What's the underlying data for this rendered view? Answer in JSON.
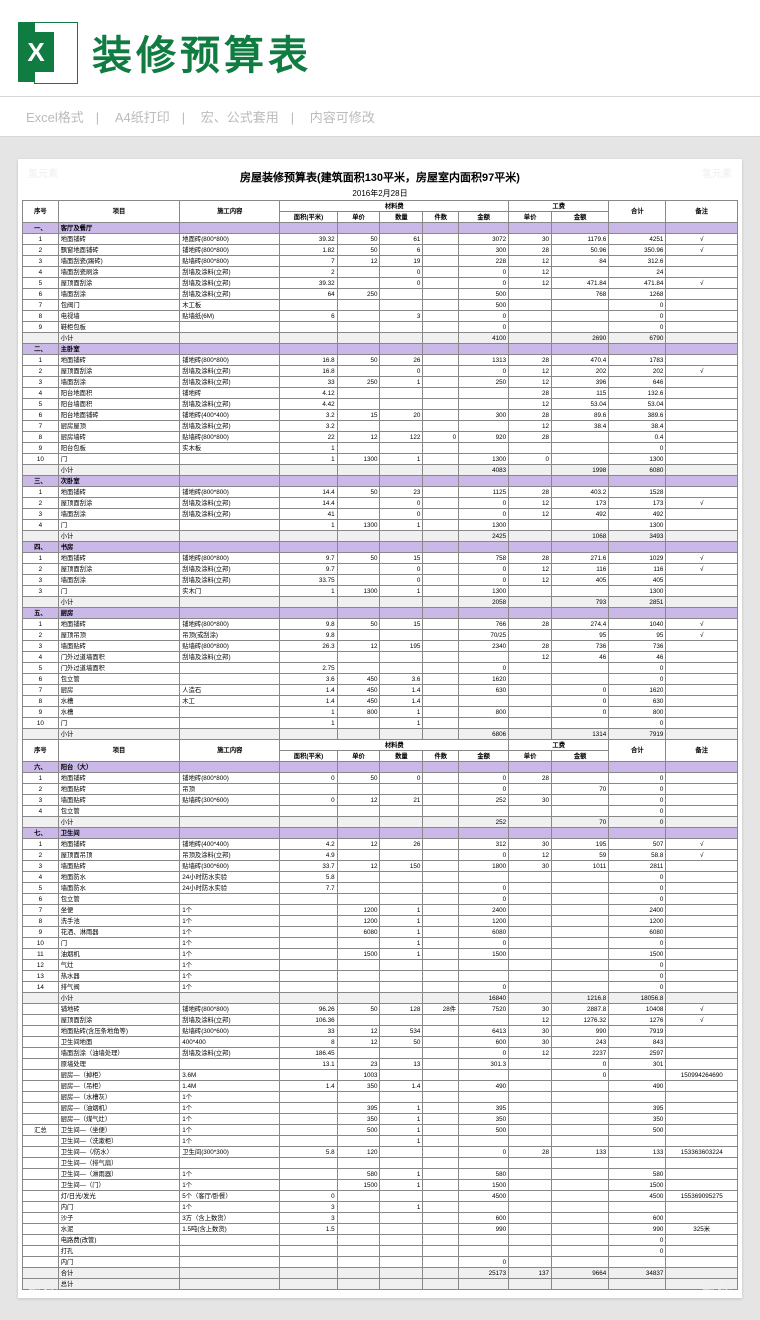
{
  "header": {
    "title": "装修预算表"
  },
  "meta": {
    "a": "Excel格式",
    "b": "A4纸打印",
    "c": "宏、公式套用",
    "d": "内容可修改"
  },
  "sheet": {
    "title": "房屋装修预算表(建筑面积130平米，房屋室内面积97平米)",
    "date": "2016年2月28日",
    "cols": [
      "序号",
      "项目",
      "施工内容",
      "面积(平米)",
      "单价",
      "数量",
      "件数",
      "金额",
      "单价",
      "金额",
      "合计",
      "备注"
    ],
    "grp": {
      "mat": "材料费",
      "lab": "工费"
    },
    "rows": [
      {
        "t": "sec",
        "n": "一、",
        "a": "客厅及餐厅"
      },
      {
        "n": "1",
        "a": "地面铺砖",
        "b": "地面砖(800*800)",
        "c": "39.32",
        "d": "50",
        "e": "61",
        "g": "3072",
        "h": "30",
        "i": "1179.6",
        "j": "4251",
        "k": "√"
      },
      {
        "n": "2",
        "a": "飘窗地面铺砖",
        "b": "铺地砖(800*800)",
        "c": "1.82",
        "d": "50",
        "e": "6",
        "g": "300",
        "h": "28",
        "i": "50.96",
        "j": "350.96",
        "k": "√"
      },
      {
        "n": "3",
        "a": "墙面刮瓷(踢砖)",
        "b": "贴墙砖(800*800)",
        "c": "7",
        "d": "12",
        "e": "19",
        "g": "228",
        "h": "12",
        "i": "84",
        "j": "312.6"
      },
      {
        "n": "4",
        "a": "墙面刮瓷刷涂",
        "b": "刮墙及涂料(立邦)",
        "c": "2",
        "e": "0",
        "g": "0",
        "h": "12",
        "j": "24"
      },
      {
        "n": "5",
        "a": "屋顶面刮涂",
        "b": "刮墙及涂料(立邦)",
        "c": "39.32",
        "e": "0",
        "g": "0",
        "h": "12",
        "i": "471.84",
        "j": "471.84",
        "k": "√"
      },
      {
        "n": "6",
        "a": "墙面刮涂",
        "b": "刮墙及涂料(立邦)",
        "c": "64",
        "d": "250",
        "g": "500",
        "i": "768",
        "j": "1268"
      },
      {
        "n": "7",
        "a": "包阀门",
        "b": "木工板",
        "g": "500",
        "j": "0"
      },
      {
        "n": "8",
        "a": "电视墙",
        "b": "贴墙纸(6M)",
        "c": "6",
        "e": "3",
        "g": "0",
        "j": "0"
      },
      {
        "n": "9",
        "a": "鞋柜包板",
        "g": "0",
        "j": "0"
      },
      {
        "t": "sub",
        "a": "小计",
        "g": "4100",
        "i": "2690",
        "j": "6790"
      },
      {
        "t": "sec",
        "n": "二、",
        "a": "主卧室"
      },
      {
        "n": "1",
        "a": "地面铺砖",
        "b": "铺地砖(800*800)",
        "c": "16.8",
        "d": "50",
        "e": "26",
        "g": "1313",
        "h": "28",
        "i": "470.4",
        "j": "1783"
      },
      {
        "n": "2",
        "a": "屋顶面刮涂",
        "b": "刮墙及涂料(立邦)",
        "c": "16.8",
        "e": "0",
        "g": "0",
        "h": "12",
        "i": "202",
        "j": "202",
        "k": "√"
      },
      {
        "n": "3",
        "a": "墙面刮涂",
        "b": "刮墙及涂料(立邦)",
        "c": "33",
        "d": "250",
        "e": "1",
        "g": "250",
        "h": "12",
        "i": "396",
        "j": "646"
      },
      {
        "n": "4",
        "a": "阳台地面积",
        "b": "铺地砖",
        "c": "4.12",
        "g": "",
        "h": "28",
        "i": "115",
        "j": "132.6"
      },
      {
        "n": "5",
        "a": "阳台墙面积",
        "b": "刮墙及涂料(立邦)",
        "c": "4.42",
        "g": "",
        "h": "12",
        "i": "53.04",
        "j": "53.04"
      },
      {
        "n": "6",
        "a": "阳台地面铺砖",
        "b": "铺地砖(400*400)",
        "c": "3.2",
        "d": "15",
        "e": "20",
        "g": "300",
        "h": "28",
        "i": "89.6",
        "j": "389.6"
      },
      {
        "n": "7",
        "a": "厨房屋顶",
        "b": "刮墙及涂料(立邦)",
        "c": "3.2",
        "g": "",
        "h": "12",
        "i": "38.4",
        "j": "38.4"
      },
      {
        "n": "8",
        "a": "厨房墙砖",
        "b": "贴墙砖(800*800)",
        "c": "22",
        "d": "12",
        "e": "122",
        "f": "0",
        "g": "920",
        "h": "28",
        "j": "0.4"
      },
      {
        "n": "9",
        "a": "阳台包板",
        "b": "实木板",
        "c": "1",
        "j": "0"
      },
      {
        "n": "10",
        "a": "门",
        "c": "1",
        "d": "1300",
        "e": "1",
        "g": "1300",
        "h": "0",
        "j": "1300"
      },
      {
        "t": "sub",
        "a": "小计",
        "g": "4083",
        "i": "1998",
        "j": "6080"
      },
      {
        "t": "sec",
        "n": "三、",
        "a": "次卧室"
      },
      {
        "n": "1",
        "a": "地面铺砖",
        "b": "铺地砖(800*800)",
        "c": "14.4",
        "d": "50",
        "e": "23",
        "g": "1125",
        "h": "28",
        "i": "403.2",
        "j": "1528"
      },
      {
        "n": "2",
        "a": "屋顶面刮涂",
        "b": "刮墙及涂料(立邦)",
        "c": "14.4",
        "e": "0",
        "g": "0",
        "h": "12",
        "i": "173",
        "j": "173",
        "k": "√"
      },
      {
        "n": "3",
        "a": "墙面刮涂",
        "b": "刮墙及涂料(立邦)",
        "c": "41",
        "e": "0",
        "g": "0",
        "h": "12",
        "i": "492",
        "j": "492"
      },
      {
        "n": "4",
        "a": "门",
        "c": "1",
        "d": "1300",
        "e": "1",
        "g": "1300",
        "j": "1300"
      },
      {
        "t": "sub",
        "a": "小计",
        "g": "2425",
        "i": "1068",
        "j": "3493"
      },
      {
        "t": "sec",
        "n": "四、",
        "a": "书房"
      },
      {
        "n": "1",
        "a": "地面铺砖",
        "b": "铺地砖(800*800)",
        "c": "9.7",
        "d": "50",
        "e": "15",
        "g": "758",
        "h": "28",
        "i": "271.6",
        "j": "1029",
        "k": "√"
      },
      {
        "n": "2",
        "a": "屋顶面刮涂",
        "b": "刮墙及涂料(立邦)",
        "c": "9.7",
        "e": "0",
        "g": "0",
        "h": "12",
        "i": "116",
        "j": "116",
        "k": "√"
      },
      {
        "n": "3",
        "a": "墙面刮涂",
        "b": "刮墙及涂料(立邦)",
        "c": "33.75",
        "e": "0",
        "g": "0",
        "h": "12",
        "i": "405",
        "j": "405"
      },
      {
        "n": "3",
        "a": "门",
        "b": "实木门",
        "c": "1",
        "d": "1300",
        "e": "1",
        "g": "1300",
        "j": "1300"
      },
      {
        "t": "sub",
        "a": "小计",
        "g": "2058",
        "i": "793",
        "j": "2851"
      },
      {
        "t": "sec",
        "n": "五、",
        "a": "厨房"
      },
      {
        "n": "1",
        "a": "地面铺砖",
        "b": "铺地砖(800*800)",
        "c": "9.8",
        "d": "50",
        "e": "15",
        "g": "766",
        "h": "28",
        "i": "274.4",
        "j": "1040",
        "k": "√"
      },
      {
        "n": "2",
        "a": "屋顶吊顶",
        "b": "吊顶(或刮涂)",
        "c": "9.8",
        "g": "70/25",
        "i": "95",
        "j": "95",
        "k": "√"
      },
      {
        "n": "3",
        "a": "墙面贴砖",
        "b": "贴墙砖(800*800)",
        "c": "26.3",
        "d": "12",
        "e": "195",
        "g": "2340",
        "h": "28",
        "i": "736",
        "j": "736"
      },
      {
        "n": "4",
        "a": "门外过道墙面积",
        "b": "刮墙及涂料(立邦)",
        "g": "",
        "h": "12",
        "i": "46",
        "j": "46"
      },
      {
        "n": "5",
        "a": "门外过道墙面积",
        "c": "2.75",
        "g": "0",
        "j": "0"
      },
      {
        "n": "6",
        "a": "包立管",
        "c": "3.6",
        "d": "450",
        "e": "3.6",
        "g": "1620",
        "j": "0"
      },
      {
        "n": "7",
        "a": "厨房",
        "b": "人造石",
        "c": "1.4",
        "d": "450",
        "e": "1.4",
        "g": "630",
        "i": "0",
        "j": "1620"
      },
      {
        "n": "8",
        "a": "水槽",
        "b": "木工",
        "c": "1.4",
        "d": "450",
        "e": "1.4",
        "g": "",
        "i": "0",
        "j": "630"
      },
      {
        "n": "9",
        "a": "水槽",
        "c": "1",
        "d": "800",
        "e": "1",
        "g": "800",
        "i": "0",
        "j": "800"
      },
      {
        "n": "10",
        "a": "门",
        "c": "1",
        "d": "",
        "e": "1",
        "g": "",
        "j": "0"
      },
      {
        "t": "sub",
        "a": "小计",
        "g": "6806",
        "i": "1314",
        "j": "7919"
      },
      {
        "t": "hdr"
      },
      {
        "t": "sec",
        "n": "六、",
        "a": "阳台（大）"
      },
      {
        "n": "1",
        "a": "地面铺砖",
        "b": "铺地砖(800*800)",
        "c": "0",
        "d": "50",
        "e": "0",
        "g": "0",
        "h": "28",
        "j": "0"
      },
      {
        "n": "2",
        "a": "地面贴砖",
        "b": "吊顶",
        "g": "0",
        "i": "70",
        "j": "0"
      },
      {
        "n": "3",
        "a": "墙面贴砖",
        "b": "贴墙砖(300*600)",
        "c": "0",
        "d": "12",
        "e": "21",
        "g": "252",
        "h": "30",
        "j": "0"
      },
      {
        "n": "4",
        "a": "包立管",
        "g": "",
        "j": "0"
      },
      {
        "t": "sub",
        "a": "小计",
        "g": "252",
        "i": "70",
        "j": "0"
      },
      {
        "t": "sec",
        "n": "七、",
        "a": "卫生间"
      },
      {
        "n": "1",
        "a": "地面铺砖",
        "b": "铺地砖(400*400)",
        "c": "4.2",
        "d": "12",
        "e": "26",
        "g": "312",
        "h": "30",
        "i": "195",
        "j": "507",
        "k": "√"
      },
      {
        "n": "2",
        "a": "屋顶面吊顶",
        "b": "吊顶及涂料(立邦)",
        "c": "4.9",
        "g": "0",
        "h": "12",
        "i": "59",
        "j": "58.8",
        "k": "√"
      },
      {
        "n": "3",
        "a": "墙面贴砖",
        "b": "贴墙砖(300*600)",
        "c": "33.7",
        "d": "12",
        "e": "150",
        "g": "1800",
        "h": "30",
        "i": "1011",
        "j": "2811"
      },
      {
        "n": "4",
        "a": "地面防水",
        "b": "24小时防水实验",
        "c": "5.8",
        "g": "",
        "j": "0"
      },
      {
        "n": "5",
        "a": "墙面防水",
        "b": "24小时防水实验",
        "c": "7.7",
        "g": "0",
        "j": "0"
      },
      {
        "n": "6",
        "a": "包立管",
        "g": "0",
        "j": "0"
      },
      {
        "n": "7",
        "a": "坐便",
        "b": "1个",
        "d": "1200",
        "e": "1",
        "g": "2400",
        "j": "2400"
      },
      {
        "n": "8",
        "a": "洗手池",
        "b": "1个",
        "d": "1200",
        "e": "1",
        "g": "1200",
        "j": "1200"
      },
      {
        "n": "9",
        "a": "花洒、淋雨器",
        "b": "1个",
        "d": "6080",
        "e": "1",
        "g": "6080",
        "j": "6080"
      },
      {
        "n": "10",
        "a": "门",
        "b": "1个",
        "d": "",
        "e": "1",
        "g": "0",
        "j": "0"
      },
      {
        "n": "11",
        "a": "油烟机",
        "b": "1个",
        "d": "1500",
        "e": "1",
        "g": "1500",
        "j": "1500"
      },
      {
        "n": "12",
        "a": "气灶",
        "b": "1个",
        "g": "",
        "j": "0"
      },
      {
        "n": "13",
        "a": "热水器",
        "b": "1个",
        "g": "",
        "j": "0"
      },
      {
        "n": "14",
        "a": "排气阀",
        "b": "1个",
        "d": "",
        "e": "",
        "g": "0",
        "j": "0"
      },
      {
        "t": "sub",
        "a": "小计",
        "g": "16840",
        "i": "1216.8",
        "j": "18056.8"
      },
      {
        "t": "sum",
        "a": "铺地砖",
        "b": "铺地砖(800*800)",
        "c": "96.26",
        "d": "50",
        "e": "128",
        "f": "28件",
        "g": "7520",
        "h": "30",
        "i": "2887.8",
        "j": "10408",
        "k": "√"
      },
      {
        "t": "sum",
        "a": "屋顶面刮涂",
        "b": "刮墙及涂料(立邦)",
        "c": "106.36",
        "g": "",
        "h": "12",
        "i": "1276.32",
        "j": "1276",
        "k": "√"
      },
      {
        "t": "sum",
        "a": "地面贴砖(含压条地角等)",
        "b": "贴墙砖(300*600)",
        "c": "33",
        "d": "12",
        "e": "534",
        "g": "6413",
        "h": "30",
        "i": "990",
        "j": "7919"
      },
      {
        "t": "sum",
        "a": "卫生间地面",
        "b": "400*400",
        "c": "8",
        "d": "12",
        "e": "50",
        "g": "600",
        "h": "30",
        "i": "243",
        "j": "843"
      },
      {
        "t": "sum",
        "a": "墙面刮涂（油墙处理）",
        "b": "刮墙及涂料(立邦)",
        "c": "186.45",
        "d": "",
        "e": "",
        "g": "0",
        "h": "12",
        "i": "2237",
        "j": "2597"
      },
      {
        "t": "sum",
        "a": "原墙处理",
        "c": "13.1",
        "d": "23",
        "e": "13",
        "g": "301.3",
        "i": "0",
        "j": "301"
      },
      {
        "t": "sum",
        "a": "厨房—（掉柜）",
        "b": "3.6M",
        "d": "1003",
        "g": "",
        "i": "0",
        "j": "",
        "k": "150994264690"
      },
      {
        "t": "sum",
        "a": "厨房—（吊柜）",
        "b": "1.4M",
        "c": "1.4",
        "d": "350",
        "e": "1.4",
        "g": "490",
        "j": "490"
      },
      {
        "t": "sum",
        "a": "厨房—（水槽灰）",
        "b": "1个",
        "g": "",
        "j": ""
      },
      {
        "t": "sum",
        "a": "厨房—（油烟机）",
        "b": "1个",
        "d": "395",
        "e": "1",
        "g": "395",
        "j": "395"
      },
      {
        "t": "sum",
        "a": "厨房—（煤气灶）",
        "b": "1个",
        "d": "350",
        "e": "1",
        "g": "350",
        "j": "350"
      },
      {
        "n": "汇总",
        "t": "sum",
        "a": "卫生间—（坐便）",
        "b": "1个",
        "d": "500",
        "e": "1",
        "g": "500",
        "j": "500"
      },
      {
        "t": "sum",
        "a": "卫生间—（洗漱柜）",
        "b": "1个",
        "d": "",
        "e": "1",
        "g": "",
        "j": ""
      },
      {
        "t": "sum",
        "a": "卫生间—（/防水）",
        "b": "卫生间(300*300)",
        "c": "5.8",
        "d": "120",
        "g": "0",
        "h": "28",
        "i": "133",
        "j": "133",
        "k": "153363603224"
      },
      {
        "t": "sum",
        "a": "卫生间—（排气扇）",
        "g": "",
        "j": ""
      },
      {
        "t": "sum",
        "a": "卫生间—（淋雨器）",
        "b": "1个",
        "d": "580",
        "e": "1",
        "g": "580",
        "j": "580"
      },
      {
        "t": "sum",
        "a": "卫生间—（门）",
        "b": "1个",
        "d": "1500",
        "e": "1",
        "g": "1500",
        "j": "1500"
      },
      {
        "t": "sum",
        "a": "灯/日光/发光",
        "b": "5个（客厅/卧餐）",
        "c": "0",
        "g": "4500",
        "j": "4500",
        "k": "155369095275"
      },
      {
        "t": "sum",
        "a": "内门",
        "b": "1个",
        "c": "3",
        "d": "",
        "e": "1",
        "g": "",
        "j": ""
      },
      {
        "t": "sum",
        "a": "沙子",
        "b": "3方（含上数货）",
        "c": "3",
        "g": "600",
        "j": "600"
      },
      {
        "t": "sum",
        "a": "水泥",
        "b": "1.5吨(含上数货)",
        "c": "1.5",
        "g": "990",
        "j": "990",
        "k": "325米"
      },
      {
        "t": "sum",
        "a": "电路费(改管)",
        "g": "",
        "j": "0"
      },
      {
        "t": "sum",
        "a": "打孔",
        "g": "",
        "j": "0"
      },
      {
        "t": "sum",
        "a": "内门",
        "g": "0",
        "j": ""
      },
      {
        "t": "sub",
        "a": "合计",
        "g": "25173",
        "h": "137",
        "i": "9664",
        "j": "34837"
      },
      {
        "t": "sub",
        "a": "总计"
      }
    ]
  }
}
